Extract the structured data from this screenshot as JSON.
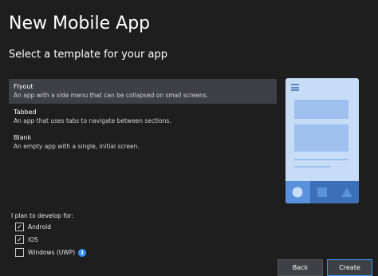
{
  "header": {
    "title": "New Mobile App",
    "subtitle": "Select a template for your app"
  },
  "templates": [
    {
      "name": "Flyout",
      "description": "An app with a side menu that can be collapsed on small screens.",
      "selected": true
    },
    {
      "name": "Tabbed",
      "description": "An app that uses tabs to navigate between sections.",
      "selected": false
    },
    {
      "name": "Blank",
      "description": "An empty app with a single, initial screen.",
      "selected": false
    }
  ],
  "platforms": {
    "label": "I plan to develop for:",
    "options": [
      {
        "label": "Android",
        "checked": true
      },
      {
        "label": "iOS",
        "checked": true
      },
      {
        "label": "Windows (UWP)",
        "checked": false,
        "info_icon": "info-icon"
      }
    ]
  },
  "buttons": {
    "back": "Back",
    "create": "Create"
  },
  "preview": {
    "icons": [
      "hamburger-icon",
      "circle-icon",
      "square-icon",
      "triangle-icon"
    ]
  },
  "colors": {
    "background": "#1e1e1e",
    "selected_row": "#3f3f46",
    "accent": "#3794ff",
    "preview_bg": "#c6dcf7",
    "preview_tabbar": "#3b6fb8"
  }
}
